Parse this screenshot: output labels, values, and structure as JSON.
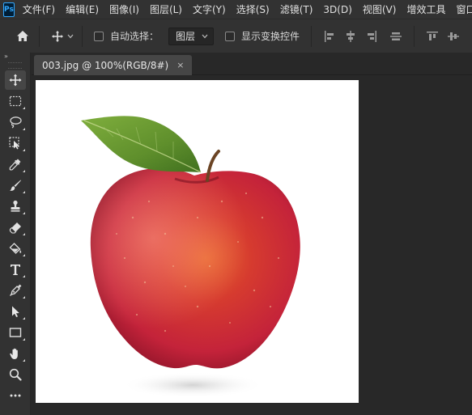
{
  "app": {
    "logo_text": "Ps"
  },
  "menu": [
    "文件(F)",
    "编辑(E)",
    "图像(I)",
    "图层(L)",
    "文字(Y)",
    "选择(S)",
    "滤镜(T)",
    "3D(D)",
    "视图(V)",
    "增效工具",
    "窗口(W)"
  ],
  "options": {
    "auto_select_label": "自动选择：",
    "auto_select_checked": false,
    "layer_select_value": "图层",
    "show_transform_label": "显示变换控件",
    "show_transform_checked": false
  },
  "toolbox": {
    "collapse_glyph": "»",
    "tools": [
      {
        "name": "move-tool-icon",
        "active": true
      },
      {
        "name": "rectangular-marquee-tool-icon"
      },
      {
        "name": "lasso-tool-icon"
      },
      {
        "name": "object-selection-tool-icon"
      },
      {
        "name": "eyedropper-tool-icon"
      },
      {
        "name": "brush-tool-icon"
      },
      {
        "name": "clone-stamp-tool-icon"
      },
      {
        "name": "eraser-tool-icon"
      },
      {
        "name": "paint-bucket-tool-icon"
      },
      {
        "name": "type-tool-icon"
      },
      {
        "name": "pen-tool-icon"
      },
      {
        "name": "path-selection-tool-icon"
      },
      {
        "name": "rectangle-tool-icon"
      },
      {
        "name": "hand-tool-icon"
      },
      {
        "name": "zoom-tool-icon"
      },
      {
        "name": "more-tools-icon"
      }
    ]
  },
  "document": {
    "tab_title": "003.jpg @ 100%(RGB/8#)",
    "close_glyph": "×",
    "canvas_image": "red-apple-with-leaf-photo"
  },
  "colors": {
    "ui_dark": "#323232",
    "workspace": "#282828",
    "accent": "#31a8ff",
    "apple_red": "#c8243a",
    "leaf_green": "#5f8f2c"
  }
}
